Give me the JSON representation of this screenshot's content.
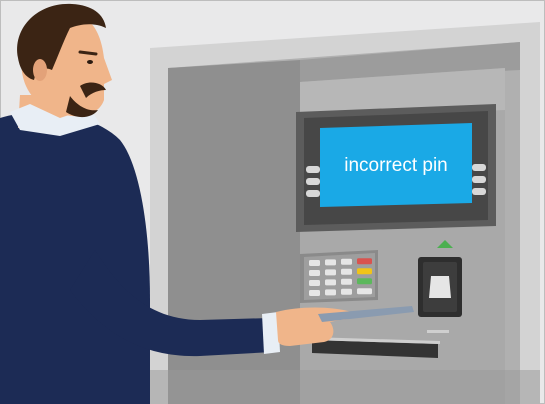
{
  "atm": {
    "screen_message": "incorrect pin",
    "colors": {
      "background": "#e8e8e8",
      "atm_body": "#a3a3a3",
      "atm_frame": "#cfcfcf",
      "screen": "#1aa9e6",
      "screen_bezel": "#5a5a5a",
      "keypad_cancel": "#d9534f",
      "keypad_clear": "#f0c419",
      "keypad_enter": "#5cb85c",
      "indicator_light": "#4caf50",
      "jacket": "#1c2b55",
      "hair": "#3b2414",
      "skin": "#f0b58a",
      "card": "#8a9bb0"
    },
    "icons": [
      "card-reader-icon",
      "keypad-icon",
      "indicator-arrow-icon"
    ]
  }
}
